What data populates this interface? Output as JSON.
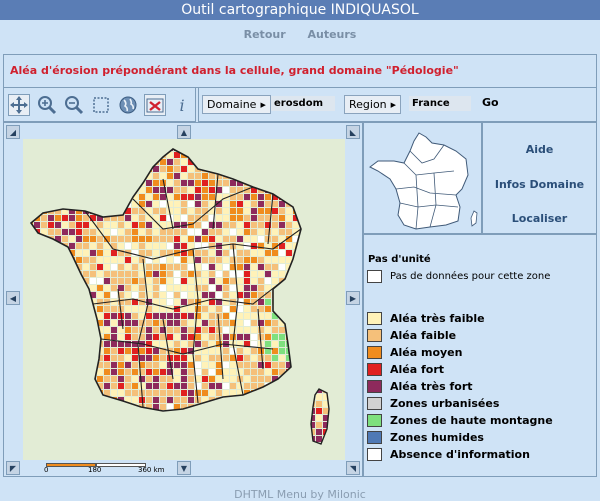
{
  "window": {
    "title": "Outil cartographique INDIQUASOL"
  },
  "nav": {
    "back": "Retour",
    "authors": "Auteurs"
  },
  "subtitle": "Aléa d'érosion prépondérant dans la cellule, grand domaine \"Pédologie\"",
  "toolbar": {
    "tools": [
      "pan-icon",
      "zoom-in-icon",
      "zoom-out-icon",
      "zoom-box-icon",
      "globe-icon",
      "scale-reset-icon",
      "info-icon"
    ]
  },
  "selectors": {
    "domain_label": "Domaine",
    "domain_value": "erosdom",
    "region_label": "Region",
    "region_value": "France",
    "go_label": "Go"
  },
  "side_links": {
    "help": "Aide",
    "domain_info": "Infos Domaine",
    "locate": "Localiser"
  },
  "map": {
    "scale": {
      "zero": "0",
      "mid": "180",
      "max": "360 km"
    }
  },
  "legend": {
    "header": "Pas d'unité",
    "no_data": "Pas de données pour cette zone",
    "items": [
      {
        "label": "Aléa très faible",
        "color": "#fff2b8"
      },
      {
        "label": "Aléa faible",
        "color": "#f5c07a"
      },
      {
        "label": "Aléa moyen",
        "color": "#f08c1e"
      },
      {
        "label": "Aléa fort",
        "color": "#e02020"
      },
      {
        "label": "Aléa très fort",
        "color": "#8e2a5c"
      },
      {
        "label": "Zones urbanisées",
        "color": "#d2d2d2"
      },
      {
        "label": "Zones de haute montagne",
        "color": "#7ee07e"
      },
      {
        "label": "Zones humides",
        "color": "#4f79b5"
      },
      {
        "label": "Absence d'information",
        "color": "#ffffff"
      }
    ]
  },
  "footer": "DHTML Menu by Milonic"
}
